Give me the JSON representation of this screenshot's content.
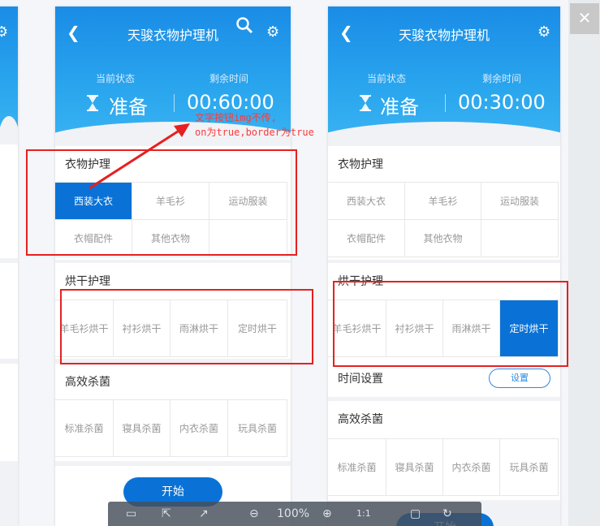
{
  "app_title": "天骏衣物护理机",
  "status_label": "当前状态",
  "remaining_label": "剩余时间",
  "status_value": "准备",
  "left": {
    "time": "00:60:00"
  },
  "right": {
    "time": "00:30:00"
  },
  "sections": {
    "care": {
      "title": "衣物护理",
      "items": [
        "西装大衣",
        "羊毛衫",
        "运动服装",
        "衣帽配件",
        "其他衣物"
      ]
    },
    "dry": {
      "title": "烘干护理",
      "items": [
        "羊毛衫烘干",
        "衬衫烘干",
        "雨淋烘干",
        "定时烘干"
      ]
    },
    "kill": {
      "title": "高效杀菌",
      "items": [
        "标准杀菌",
        "寝具杀菌",
        "内衣杀菌",
        "玩具杀菌"
      ]
    }
  },
  "time_setting": {
    "label": "时间设置",
    "button": "设置"
  },
  "start_button": "开始",
  "annotation": {
    "line1": "文字按钮img不传,",
    "line2": "on为true,border为true"
  },
  "viewer": {
    "zoom": "100%",
    "one_to_one": "1:1"
  },
  "colors": {
    "accent": "#0a72d6",
    "annotation": "#e62020",
    "header_top": "#1a8ce6"
  },
  "icons": [
    "back-icon",
    "search-icon",
    "gear-icon",
    "hourglass-icon",
    "close-icon",
    "save-icon",
    "export-icon",
    "share-icon",
    "zoom-out-icon",
    "zoom-in-icon",
    "fit-icon",
    "rotate-icon"
  ]
}
